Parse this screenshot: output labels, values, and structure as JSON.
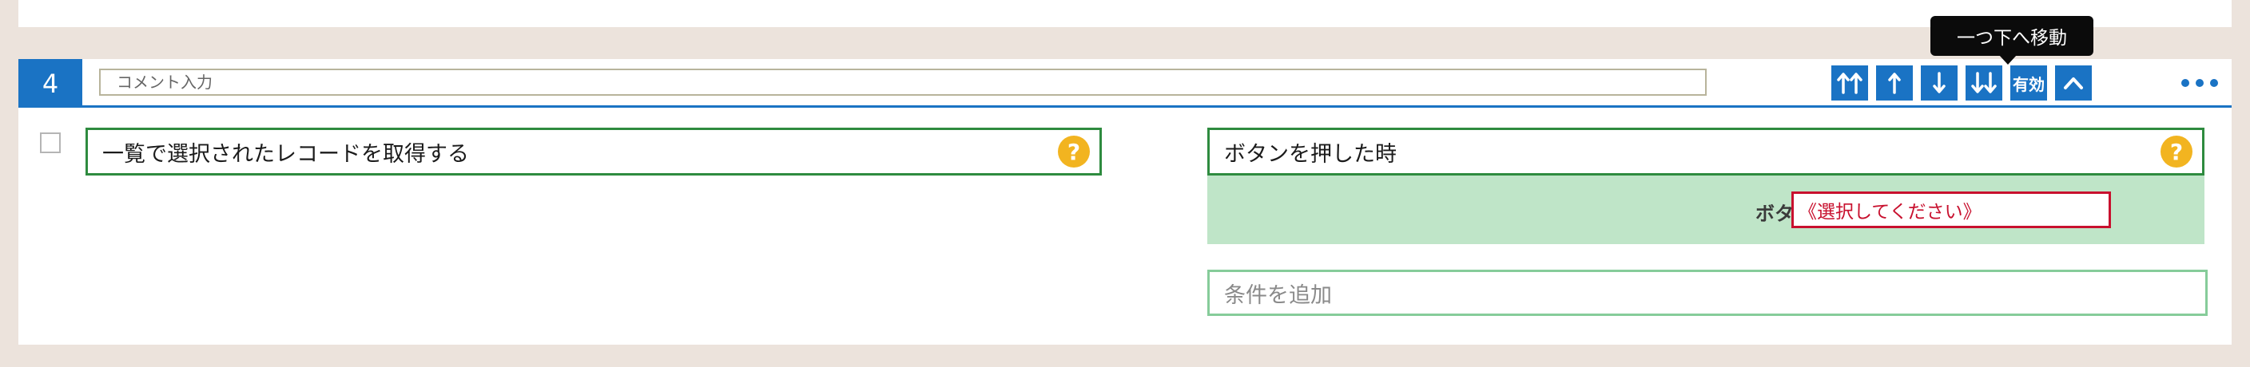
{
  "row": {
    "number": "4",
    "comment_placeholder": "コメント入力"
  },
  "toolbar": {
    "move_top_icon": "move-to-top-icon",
    "move_up_icon": "move-up-icon",
    "move_down_icon": "move-down-icon",
    "move_bottom_icon": "move-to-bottom-icon",
    "enabled_label": "有効",
    "collapse_icon": "chevron-up-icon",
    "more_icon": "more-horizontal-icon",
    "tooltip": "一つ下へ移動"
  },
  "action": {
    "label": "一覧で選択されたレコードを取得する",
    "help": "?"
  },
  "trigger": {
    "label": "ボタンを押した時",
    "help": "?",
    "param_label": "ボタン",
    "param_value": "《選択してください》"
  },
  "condition": {
    "add_label": "条件を追加"
  },
  "colors": {
    "accent_blue": "#1a73c4",
    "green_border": "#2e8b3f",
    "param_bg": "#bfe5c8",
    "error_red": "#c8102e",
    "help_yellow": "#f2b420"
  }
}
